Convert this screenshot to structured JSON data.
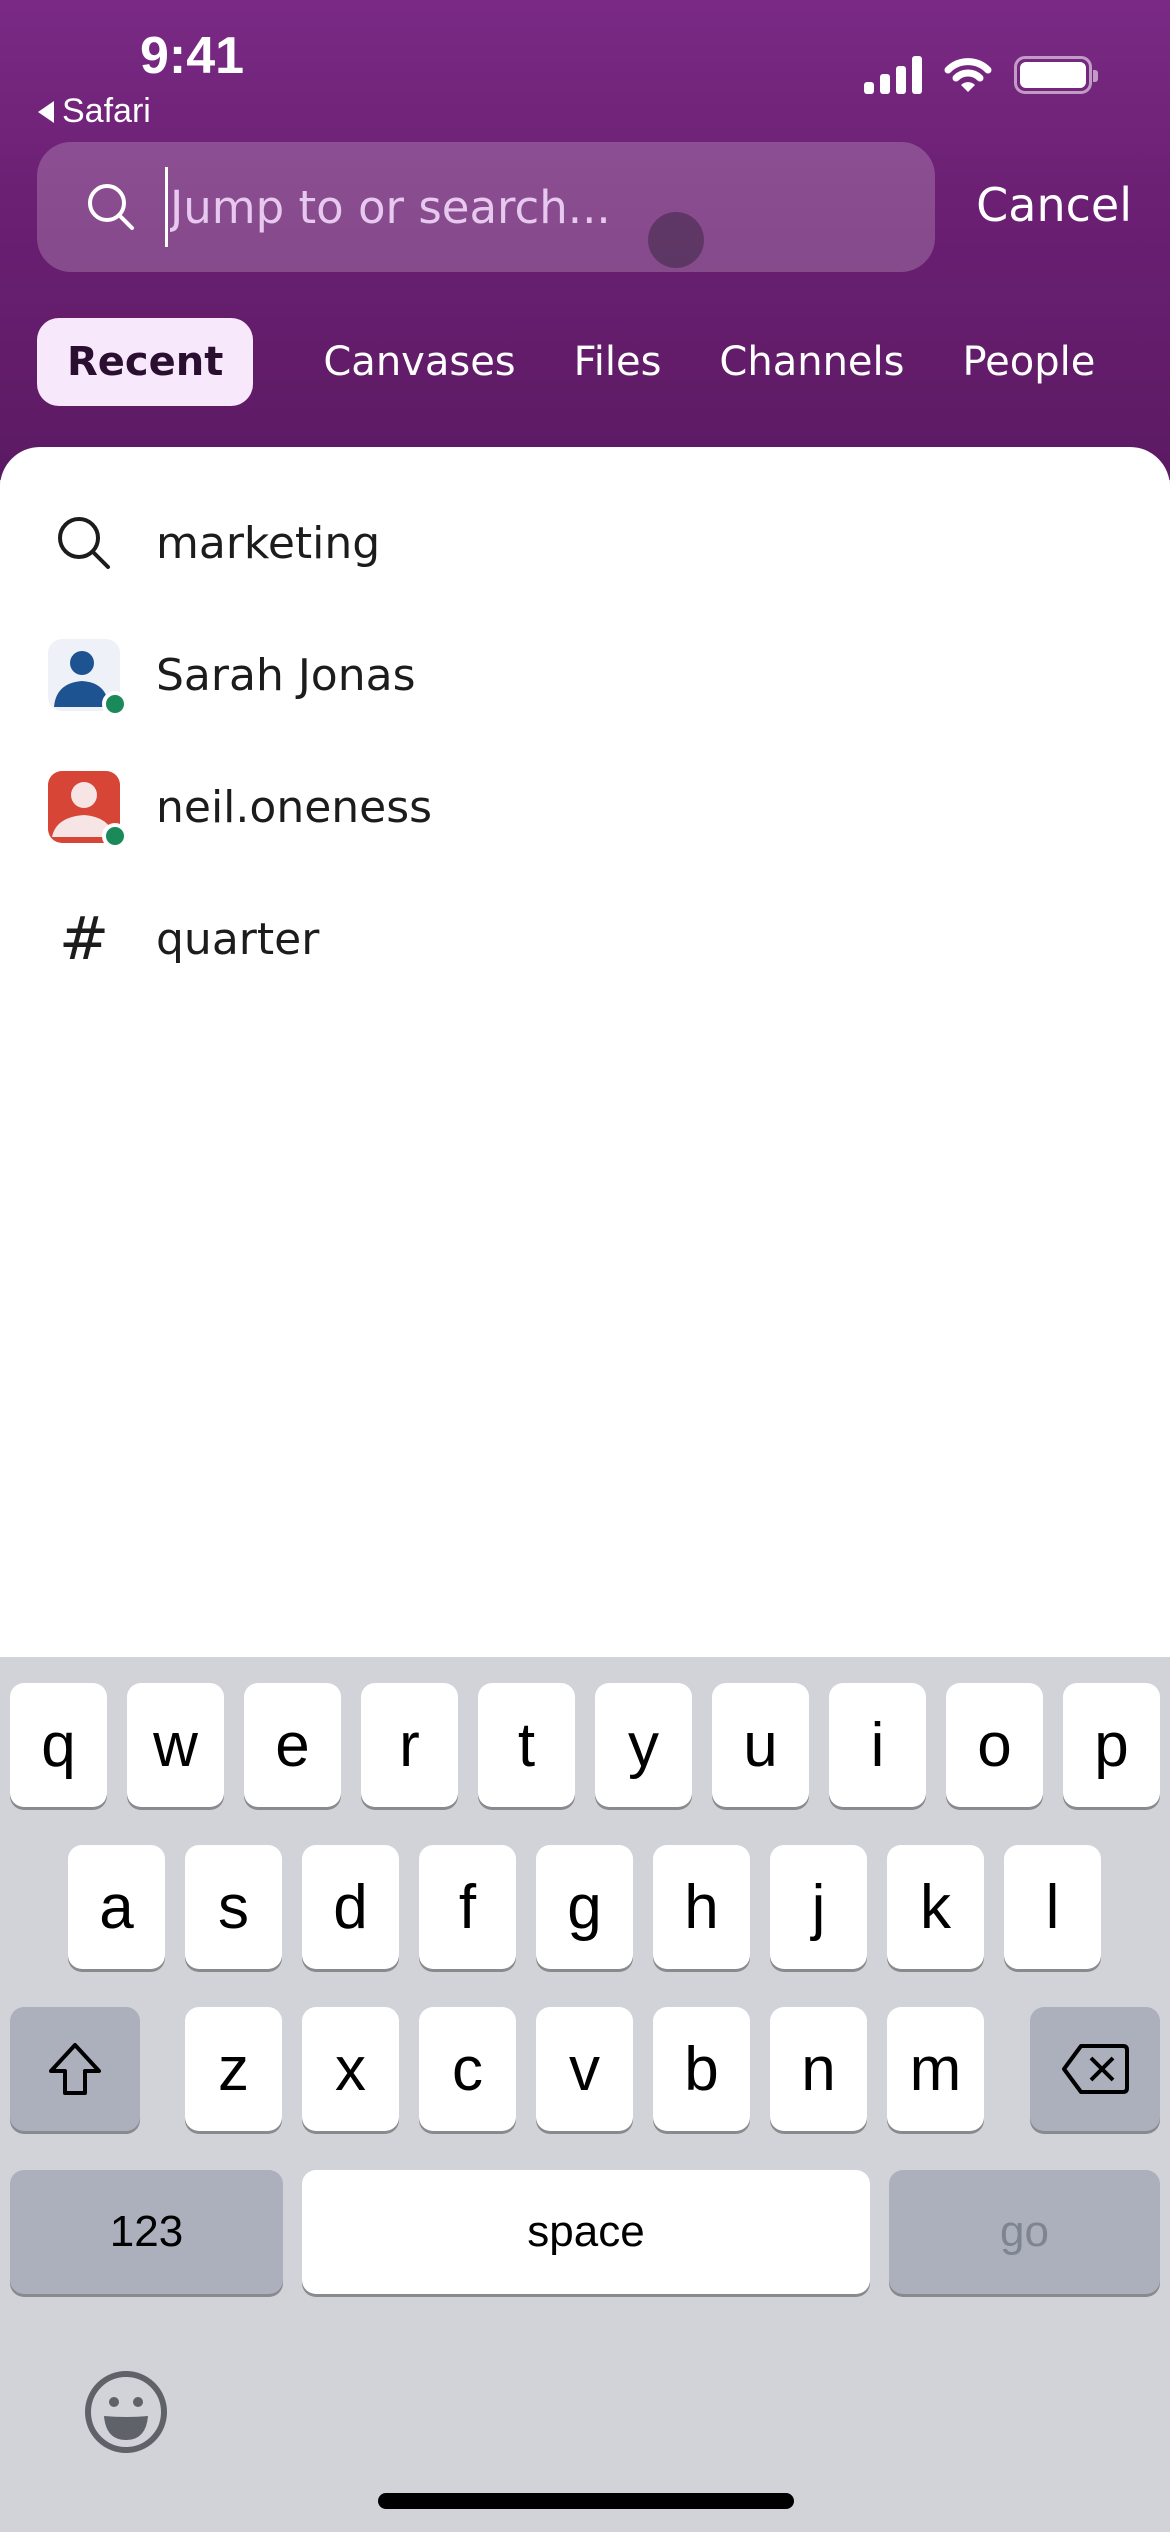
{
  "status_bar": {
    "time": "9:41",
    "back_app": "Safari"
  },
  "search": {
    "placeholder": "Jump to or search...",
    "value": "",
    "cancel_label": "Cancel"
  },
  "tabs": [
    {
      "label": "Recent",
      "active": true
    },
    {
      "label": "Canvases",
      "active": false
    },
    {
      "label": "Files",
      "active": false
    },
    {
      "label": "Channels",
      "active": false
    },
    {
      "label": "People",
      "active": false
    }
  ],
  "recent_items": [
    {
      "type": "search-query",
      "icon": "search-icon",
      "label": "marketing"
    },
    {
      "type": "person",
      "icon": "user-avatar",
      "label": "Sarah Jonas",
      "avatar_color": "#1d5391",
      "avatar_bg": "#eef2f8",
      "status": "online"
    },
    {
      "type": "person",
      "icon": "user-avatar",
      "label": "neil.oneness",
      "avatar_color": "#d64535",
      "avatar_bg": "#d64535",
      "status": "online"
    },
    {
      "type": "channel",
      "icon": "hash-icon",
      "label": "quarter"
    }
  ],
  "colors": {
    "header_purple": "#6a1f72",
    "presence_online": "#1a8a5a",
    "active_tab_bg": "#f8e8fb"
  },
  "keyboard": {
    "row1": [
      "q",
      "w",
      "e",
      "r",
      "t",
      "y",
      "u",
      "i",
      "o",
      "p"
    ],
    "row2": [
      "a",
      "s",
      "d",
      "f",
      "g",
      "h",
      "j",
      "k",
      "l"
    ],
    "row3": [
      "z",
      "x",
      "c",
      "v",
      "b",
      "n",
      "m"
    ],
    "numbers_label": "123",
    "space_label": "space",
    "go_label": "go"
  }
}
